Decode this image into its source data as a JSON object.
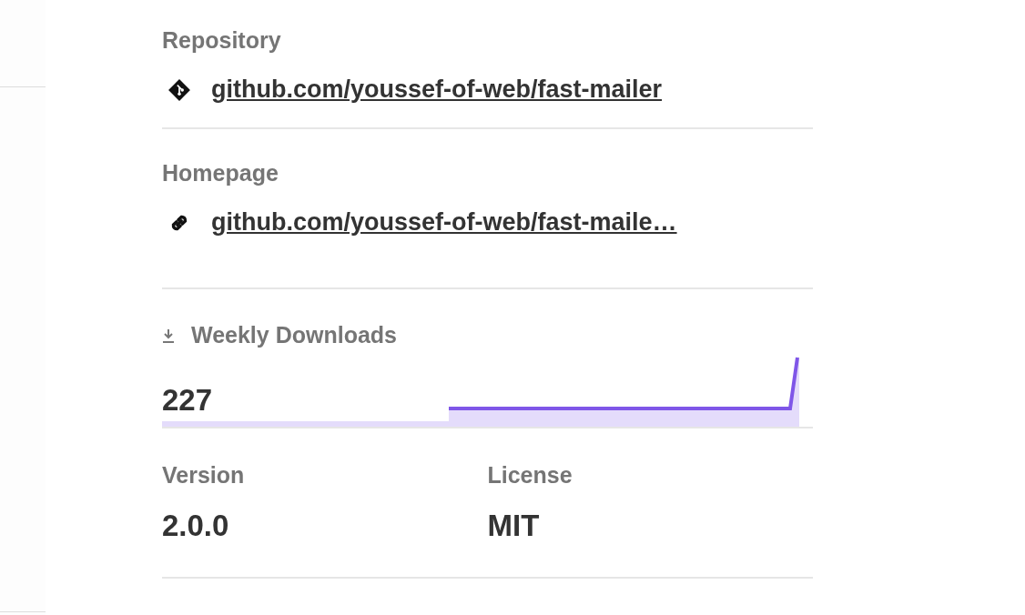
{
  "repository": {
    "label": "Repository",
    "link": "github.com/youssef-of-web/fast-mailer"
  },
  "homepage": {
    "label": "Homepage",
    "link": "github.com/youssef-of-web/fast-maile…"
  },
  "weekly_downloads": {
    "label": "Weekly Downloads",
    "value": "227"
  },
  "stats": [
    {
      "label": "Version",
      "value": "2.0.0"
    },
    {
      "label": "License",
      "value": "MIT"
    }
  ]
}
